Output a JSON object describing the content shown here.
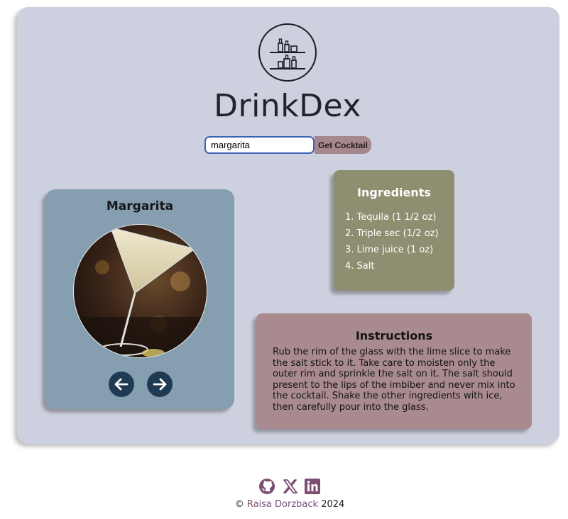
{
  "app": {
    "title": "DrinkDex"
  },
  "search": {
    "value": "margarita",
    "button_label": "Get Cocktail"
  },
  "drink": {
    "name": "Margarita"
  },
  "ingredients": {
    "title": "Ingredients",
    "items": [
      "1. Tequila (1 1/2 oz)",
      "2. Triple sec (1/2 oz)",
      "3. Lime juice (1 oz)",
      "4. Salt"
    ]
  },
  "instructions": {
    "title": "Instructions",
    "text": "Rub the rim of the glass with the lime slice to make the salt stick to it. Take care to moisten only the outer rim and sprinkle the salt on it. The salt should present to the lips of the imbiber and never mix into the cocktail. Shake the other ingredients with ice, then carefully pour into the glass."
  },
  "footer": {
    "copyright_symbol": "©",
    "author": "Raisa Dorzback",
    "year": "2024",
    "social": [
      "github-icon",
      "x-icon",
      "linkedin-icon"
    ]
  },
  "colors": {
    "panel": "#cdd0de",
    "drink_card": "#859fb0",
    "ingredients_card": "#8e8e71",
    "instructions_card": "#a88a8f",
    "button": "#a4888d",
    "nav_button": "#1f3a53",
    "social_icon": "#7b4f72"
  }
}
